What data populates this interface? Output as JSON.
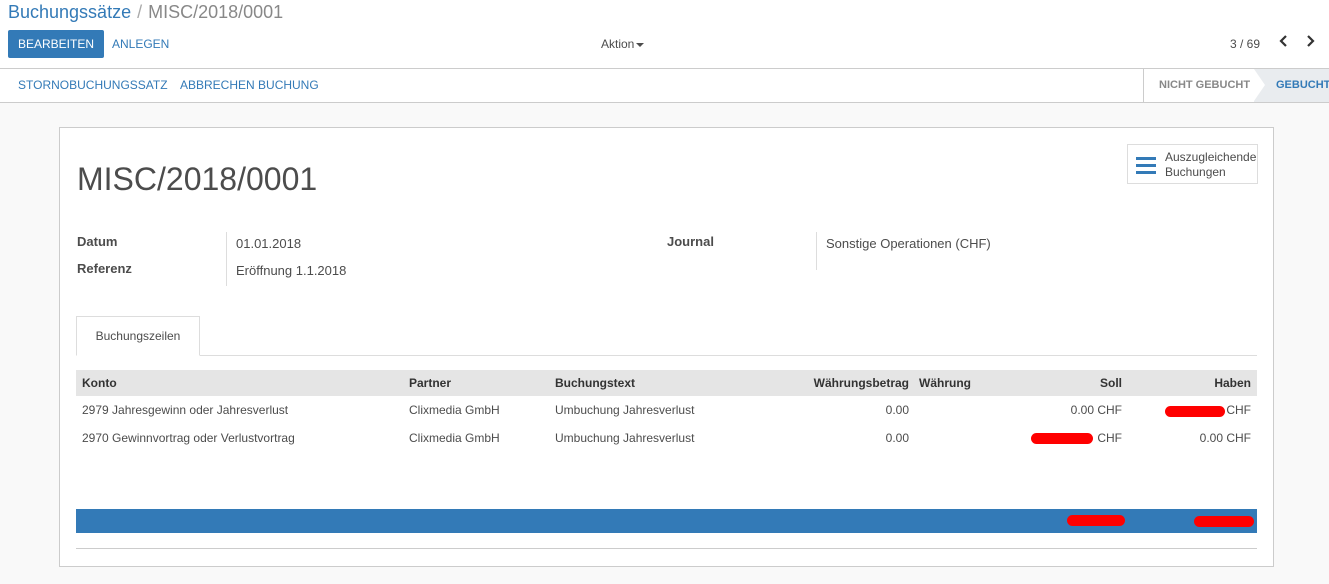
{
  "breadcrumb": {
    "parent": "Buchungssätze",
    "separator": "/",
    "current": "MISC/2018/0001"
  },
  "toolbar": {
    "edit_label": "BEARBEITEN",
    "create_label": "ANLEGEN",
    "action_label": "Aktion"
  },
  "pager": {
    "text": "3 / 69",
    "prev_icon": "chevron-left-icon",
    "next_icon": "chevron-right-icon"
  },
  "statusbar": {
    "buttons": [
      "STORNOBUCHUNGSSATZ",
      "ABBRECHEN BUCHUNG"
    ],
    "states": [
      {
        "label": "NICHT GEBUCHT",
        "active": false
      },
      {
        "label": "GEBUCHT",
        "active": true
      }
    ]
  },
  "stat_button": {
    "icon": "list-icon",
    "line1": "Auszugleichende",
    "line2": "Buchungen"
  },
  "record": {
    "title": "MISC/2018/0001",
    "fields": {
      "date_label": "Datum",
      "date_value": "01.01.2018",
      "ref_label": "Referenz",
      "ref_value": "Eröffnung 1.1.2018",
      "journal_label": "Journal",
      "journal_value": "Sonstige Operationen (CHF)"
    }
  },
  "tabs": [
    "Buchungszeilen"
  ],
  "table": {
    "columns": [
      "Konto",
      "Partner",
      "Buchungstext",
      "Währungsbetrag",
      "Währung",
      "Soll",
      "Haben"
    ],
    "rows": [
      {
        "konto": "2979 Jahresgewinn oder Jahresverlust",
        "partner": "Clixmedia GmbH",
        "text": "Umbuchung Jahresverlust",
        "amount_currency": "0.00",
        "currency": "",
        "debit": "0.00 CHF",
        "credit_suffix": "CHF",
        "credit_redacted": true
      },
      {
        "konto": "2970 Gewinnvortrag oder Verlustvortrag",
        "partner": "Clixmedia GmbH",
        "text": "Umbuchung Jahresverlust",
        "amount_currency": "0.00",
        "currency": "",
        "debit_suffix": "CHF",
        "debit_redacted": true,
        "credit": "0.00 CHF"
      }
    ]
  },
  "colors": {
    "primary": "#337ab7",
    "redaction": "#ff0000",
    "header_bg": "#e5e5e5"
  }
}
